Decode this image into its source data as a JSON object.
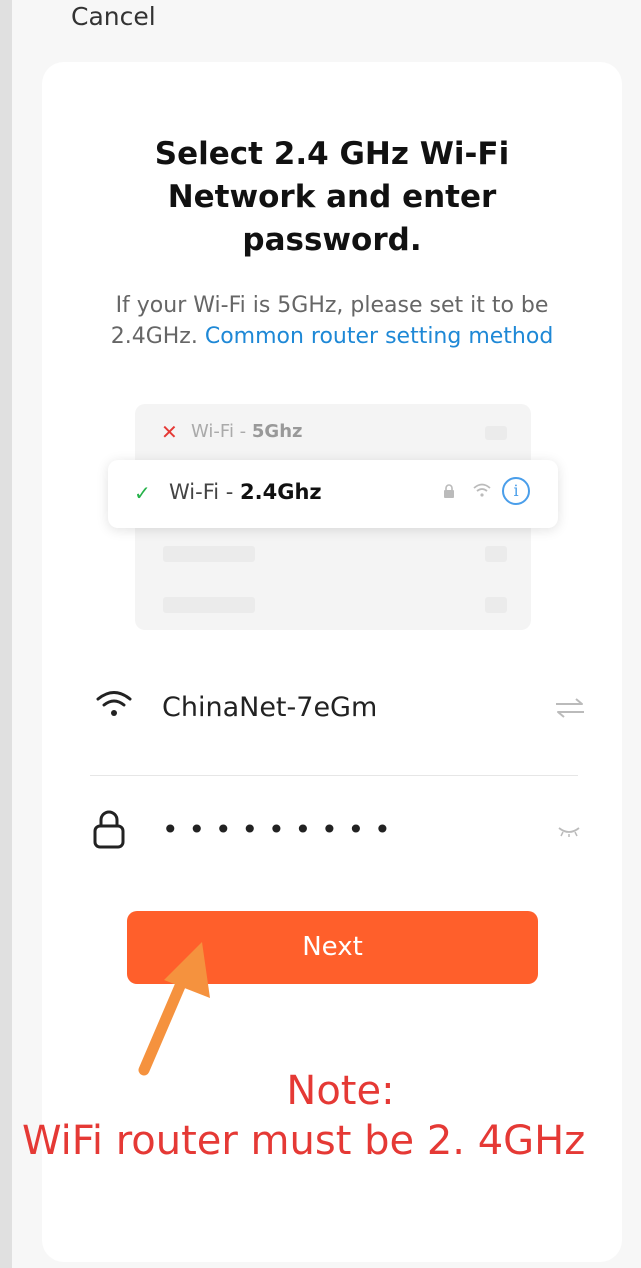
{
  "header": {
    "cancel_label": "Cancel"
  },
  "title": {
    "line1": "Select 2.4 GHz Wi-Fi",
    "line2": "Network and enter",
    "line3": "password."
  },
  "subtitle": {
    "line1": "If your Wi-Fi is 5GHz, please set it to be",
    "line2_prefix": "2.4GHz.",
    "link": "Common router setting method"
  },
  "illustration": {
    "row_5ghz": {
      "prefix": "Wi-Fi - ",
      "band": "5Ghz"
    },
    "row_24ghz": {
      "prefix": "Wi-Fi - ",
      "band": "2.4Ghz"
    },
    "info_glyph": "i"
  },
  "wifi_field": {
    "ssid": "ChinaNet-7eGm"
  },
  "password_field": {
    "masked_value": "•••••••••"
  },
  "next_button": {
    "label": "Next"
  },
  "note": {
    "line1": "Note:",
    "line2": "WiFi router must be 2. 4GHz"
  },
  "colors": {
    "accent": "#ff5f2b",
    "link": "#1e88d6",
    "note": "#e53935",
    "check": "#26b24a",
    "cross": "#e53935",
    "arrow": "#f5923e"
  },
  "icons": [
    "wifi-icon",
    "lock-icon",
    "switch-network-icon",
    "eye-closed-icon",
    "check-icon",
    "cross-icon",
    "info-icon",
    "arrow-icon"
  ]
}
